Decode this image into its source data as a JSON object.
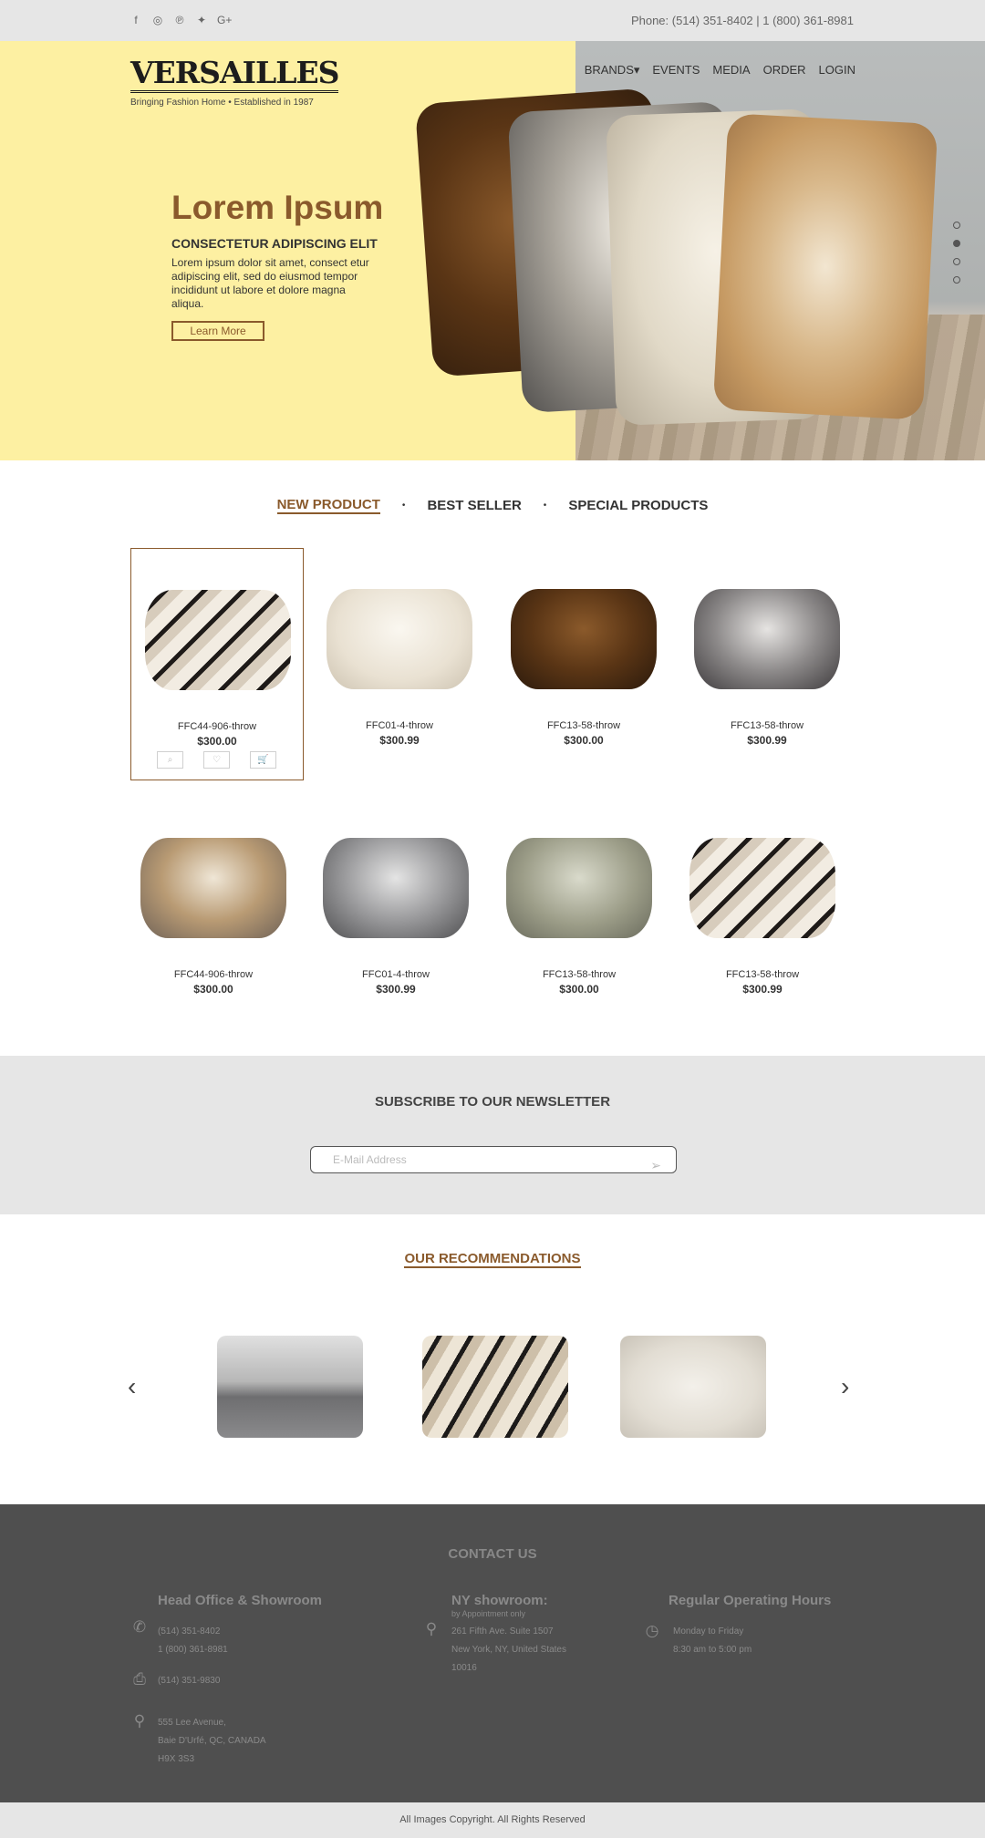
{
  "topbar": {
    "social": [
      "f",
      "◎",
      "℗",
      "✦",
      "G+"
    ],
    "phone": "Phone: (514) 351-8402 | 1 (800) 361-8981"
  },
  "brand": {
    "logo": "VERSAILLES",
    "tagline": "Bringing Fashion Home • Established in 1987"
  },
  "nav": {
    "brands": "BRANDS▾",
    "events": "EVENTS",
    "media": "MEDIA",
    "order": "ORDER",
    "login": "LOGIN"
  },
  "hero": {
    "title": "Lorem Ipsum",
    "subtitle": "CONSECTETUR ADIPISCING ELIT",
    "body": "Lorem ipsum dolor sit amet, consect etur adipiscing elit, sed do eiusmod tempor incididunt ut labore et dolore magna aliqua.",
    "cta": "Learn More",
    "slides_total": 4,
    "active_slide": 2
  },
  "tabs": {
    "new": "NEW PRODUCT",
    "best": "BEST SELLER",
    "special": "SPECIAL PRODUCTS",
    "sep": "•"
  },
  "products": [
    {
      "name": "FFC44-906-throw",
      "price": "$300.00"
    },
    {
      "name": "FFC01-4-throw",
      "price": "$300.99"
    },
    {
      "name": "FFC13-58-throw",
      "price": "$300.00"
    },
    {
      "name": "FFC13-58-throw",
      "price": "$300.99"
    },
    {
      "name": "FFC44-906-throw",
      "price": "$300.00"
    },
    {
      "name": "FFC01-4-throw",
      "price": "$300.99"
    },
    {
      "name": "FFC13-58-throw",
      "price": "$300.00"
    },
    {
      "name": "FFC13-58-throw",
      "price": "$300.99"
    }
  ],
  "product_actions": {
    "search": "⌕",
    "wishlist": "♡",
    "cart": "🛒"
  },
  "newsletter": {
    "title": "SUBSCRIBE TO OUR NEWSLETTER",
    "placeholder": "E-Mail Address",
    "send_icon": "➢"
  },
  "recommendations": {
    "title": "OUR RECOMMENDATIONS",
    "prev": "‹",
    "next": "›"
  },
  "footer": {
    "title": "CONTACT US",
    "head_office": {
      "heading": "Head Office & Showroom",
      "phone1": "(514) 351-8402",
      "phone2": "1 (800) 361-8981",
      "fax": "(514) 351-9830",
      "addr1": "555 Lee Avenue,",
      "addr2": "Baie D'Urfé, QC, CANADA",
      "addr3": "H9X 3S3"
    },
    "ny": {
      "heading": "NY showroom:",
      "note": "by Appointment only",
      "addr1": "261 Fifth Ave. Suite 1507",
      "addr2": "New York, NY, United States",
      "addr3": "10016"
    },
    "hours": {
      "heading": "Regular Operating Hours",
      "days": "Monday to Friday",
      "time": "8:30 am to 5:00 pm"
    }
  },
  "copyright": "All Images Copyright. All Rights Reserved",
  "colors": {
    "accent": "#8a5a2c",
    "hero_bg": "#fdf0a2",
    "footer_bg": "#4f4f4f",
    "bar_bg": "#e6e6e6"
  }
}
